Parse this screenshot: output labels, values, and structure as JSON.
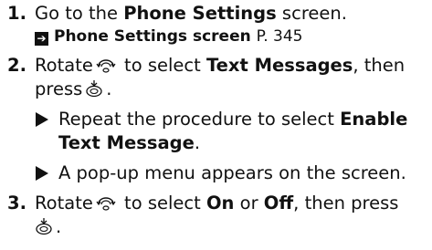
{
  "steps": [
    {
      "num": "1.",
      "pre": "Go to the ",
      "bold": "Phone Settings",
      "post": " screen.",
      "ref": {
        "title": "Phone Settings screen",
        "page": "P. 345"
      }
    },
    {
      "num": "2.",
      "pre": "Rotate",
      "mid1": " to select ",
      "bold": "Text Messages",
      "mid2": ", then press",
      "end": ".",
      "subs": [
        {
          "pre": "Repeat the procedure to select ",
          "bold": "Enable Text Message",
          "post": "."
        },
        {
          "text": "A pop-up menu appears on the screen."
        }
      ]
    },
    {
      "num": "3.",
      "pre": "Rotate",
      "mid1": " to select ",
      "bold1": "On",
      "mid2": " or ",
      "bold2": "Off",
      "mid3": ", then press",
      "end": "."
    }
  ],
  "icons": {
    "ref": "arrow-right-box-icon",
    "rotate": "interface-dial-rotate-icon",
    "press": "interface-dial-press-icon",
    "sub": "triangle-bullet-icon"
  }
}
